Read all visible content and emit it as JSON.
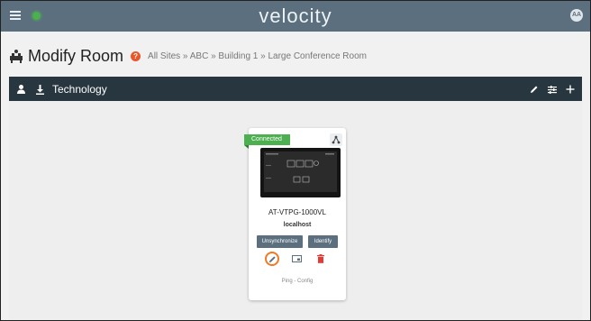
{
  "app": {
    "logo_text": "velocity",
    "avatar_initials": "AA"
  },
  "page": {
    "title": "Modify Room",
    "breadcrumb": [
      "All Sites",
      "ABC",
      "Building 1",
      "Large Conference Room"
    ],
    "breadcrumb_separator": " » "
  },
  "section": {
    "title": "Technology"
  },
  "device": {
    "status": "Connected",
    "model": "AT-VTPG-1000VL",
    "host": "localhost",
    "unsync_label": "Unsynchronize",
    "identify_label": "Identify",
    "footer_label": "Ping - Config"
  },
  "colors": {
    "topbar": "#5b6f7f",
    "section_bar": "#27363f",
    "status_green": "#4caf50",
    "highlight_orange": "#f07a23",
    "delete_red": "#e53935"
  },
  "icons": [
    "menu-icon",
    "status-dot",
    "avatar",
    "room-icon",
    "help-icon",
    "user-icon",
    "download-icon",
    "edit-icon",
    "settings-icon",
    "add-icon",
    "device-tree-icon",
    "screen-icon",
    "trash-icon"
  ]
}
